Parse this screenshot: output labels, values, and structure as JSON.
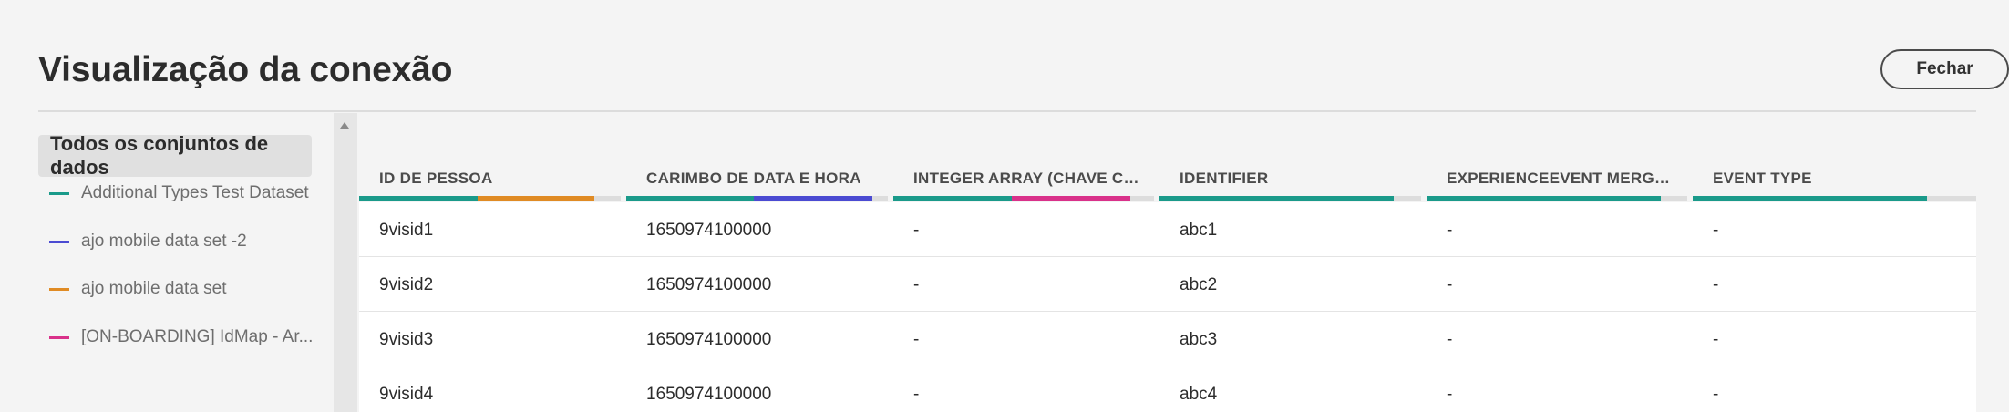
{
  "header": {
    "title": "Visualização da conexão",
    "close_label": "Fechar"
  },
  "sidebar": {
    "all_label": "Todos os conjuntos de dados",
    "datasets": [
      {
        "label": "Additional Types Test Dataset",
        "color": "#1a9a8a"
      },
      {
        "label": "ajo mobile data set -2",
        "color": "#4b4bd2"
      },
      {
        "label": "ajo mobile data set",
        "color": "#e08b24"
      },
      {
        "label": "[ON-BOARDING] IdMap - Ar...",
        "color": "#d9318a"
      }
    ]
  },
  "table": {
    "columns": [
      {
        "label": "ID DE PESSOA",
        "colors": [
          "#1a9a8a",
          "#e08b24"
        ]
      },
      {
        "label": "CARIMBO DE DATA E HORA",
        "colors": [
          "#1a9a8a",
          "#4b4bd2"
        ]
      },
      {
        "label": "INTEGER ARRAY (CHAVE COR...",
        "colors": [
          "#1a9a8a",
          "#d9318a"
        ]
      },
      {
        "label": "IDENTIFIER",
        "colors": [
          "#1a9a8a"
        ]
      },
      {
        "label": "EXPERIENCEEVENT MERGE ID",
        "colors": [
          "#1a9a8a"
        ]
      },
      {
        "label": "EVENT TYPE",
        "colors": [
          "#1a9a8a"
        ]
      }
    ],
    "rows": [
      [
        "9visid1",
        "1650974100000",
        "-",
        "abc1",
        "-",
        "-"
      ],
      [
        "9visid2",
        "1650974100000",
        "-",
        "abc2",
        "-",
        "-"
      ],
      [
        "9visid3",
        "1650974100000",
        "-",
        "abc3",
        "-",
        "-"
      ],
      [
        "9visid4",
        "1650974100000",
        "-",
        "abc4",
        "-",
        "-"
      ]
    ]
  }
}
